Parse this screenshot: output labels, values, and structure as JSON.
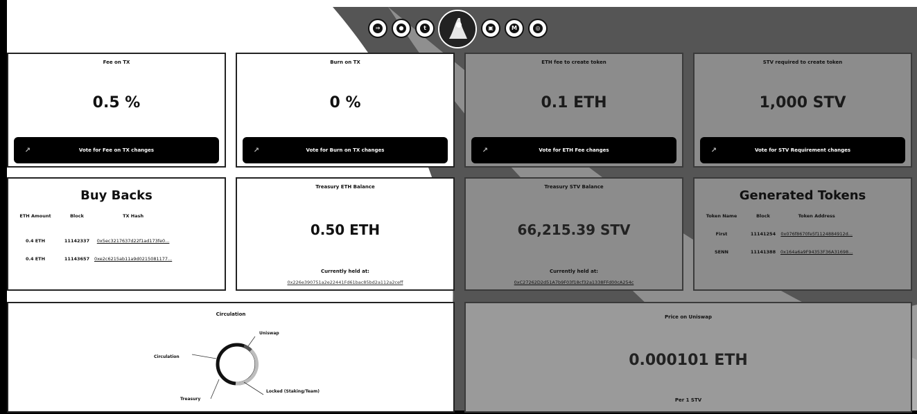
{
  "header": {
    "icons": [
      {
        "name": "arrow-icon",
        "glyph": "⇒"
      },
      {
        "name": "disc-icon",
        "glyph": "●"
      },
      {
        "name": "twitter-icon",
        "glyph": "t"
      },
      {
        "name": "chat-icon",
        "glyph": "▣"
      },
      {
        "name": "medium-icon",
        "glyph": "M"
      },
      {
        "name": "github-icon",
        "glyph": "◎"
      }
    ]
  },
  "fee": {
    "title": "Fee on TX",
    "value": "0.5 %",
    "vote": "Vote for Fee on TX changes"
  },
  "burn": {
    "title": "Burn on TX",
    "value": "0 %",
    "vote": "Vote for Burn on TX changes"
  },
  "ethfee": {
    "title": "ETH fee to create token",
    "value": "0.1 ETH",
    "vote": "Vote for ETH Fee changes"
  },
  "stvreq": {
    "title": "STV required to create token",
    "value": "1,000 STV",
    "vote": "Vote for STV Requirement changes"
  },
  "buybacks": {
    "title": "Buy Backs",
    "headers": [
      "ETH Amount",
      "Block",
      "TX Hash"
    ],
    "rows": [
      [
        "0.4 ETH",
        "11142337",
        "0x5ec3217637d22f1ad173fe0..."
      ],
      [
        "0.4 ETH",
        "11143657",
        "0xe2c6215ab11a9d0215081177..."
      ]
    ]
  },
  "treasury_eth": {
    "title": "Treasury ETH Balance",
    "value": "0.50 ETH",
    "held": "Currently held at:",
    "address": "0x226e390751a2e22441Fd61bac85bd2a112a2ceff"
  },
  "treasury_stv": {
    "title": "Treasury STV Balance",
    "value": "66,215.39 STV",
    "held": "Currently held at:",
    "address": "0xC27262D2d51A7b9F03f18cf32a1338FFd00cA254c"
  },
  "generated": {
    "title": "Generated Tokens",
    "headers": [
      "Token Name",
      "Block",
      "Token Address"
    ],
    "rows": [
      [
        "First",
        "11141254",
        "0x076f8670fe5f1124884912d..."
      ],
      [
        "SENN",
        "11141388",
        "0x164a6a9F94353F36A31698..."
      ]
    ]
  },
  "circulation": {
    "title": "Circulation",
    "labels": [
      "Uniswap",
      "Circulation",
      "Locked (Staking/Team)",
      "Treasury"
    ]
  },
  "price": {
    "title": "Price on Uniswap",
    "value": "0.000101 ETH",
    "per": "Per 1 STV"
  },
  "colors": {
    "dark_panel": "#8c8c8c",
    "light_panel": "#ffffff",
    "button": "#000000"
  }
}
